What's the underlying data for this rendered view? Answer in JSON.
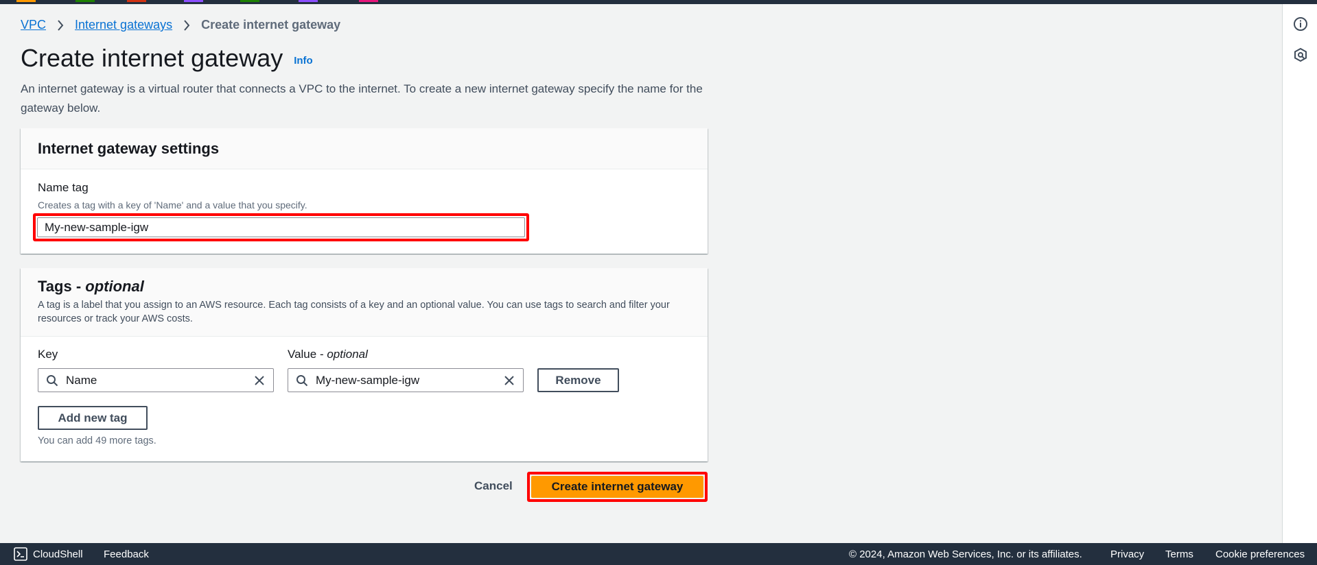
{
  "colors": {
    "accent_link": "#0972d3",
    "primary_button": "#ff9900",
    "highlight": "#ff0000",
    "top_bar": "#232f3e",
    "footer": "#232f3e",
    "page_bg": "#f2f3f3"
  },
  "breadcrumb": {
    "items": [
      {
        "label": "VPC"
      },
      {
        "label": "Internet gateways"
      },
      {
        "label": "Create internet gateway"
      }
    ]
  },
  "header": {
    "title": "Create internet gateway",
    "info_label": "Info",
    "description": "An internet gateway is a virtual router that connects a VPC to the internet. To create a new internet gateway specify the name for the gateway below."
  },
  "settings_panel": {
    "title": "Internet gateway settings",
    "name_tag": {
      "label": "Name tag",
      "description": "Creates a tag with a key of 'Name' and a value that you specify.",
      "value": "My-new-sample-igw"
    }
  },
  "tags_panel": {
    "title_prefix": "Tags - ",
    "title_suffix": "optional",
    "description": "A tag is a label that you assign to an AWS resource. Each tag consists of a key and an optional value. You can use tags to search and filter your resources or track your AWS costs.",
    "key_label": "Key",
    "value_label_prefix": "Value - ",
    "value_label_suffix": "optional",
    "tags": [
      {
        "key": "Name",
        "value": "My-new-sample-igw"
      }
    ],
    "remove_label": "Remove",
    "add_label": "Add new tag",
    "hint": "You can add 49 more tags."
  },
  "actions": {
    "cancel_label": "Cancel",
    "submit_label": "Create internet gateway"
  },
  "footer": {
    "cloudshell_label": "CloudShell",
    "feedback_label": "Feedback",
    "copyright": "© 2024, Amazon Web Services, Inc. or its affiliates.",
    "privacy_label": "Privacy",
    "terms_label": "Terms",
    "cookie_label": "Cookie preferences"
  },
  "icons": {
    "right_rail": [
      "info-icon",
      "feedback-gear-icon"
    ],
    "search": "search-icon",
    "clear": "close-icon",
    "breadcrumb_separator": "chevron-right-icon",
    "cloudshell": "terminal-icon"
  }
}
